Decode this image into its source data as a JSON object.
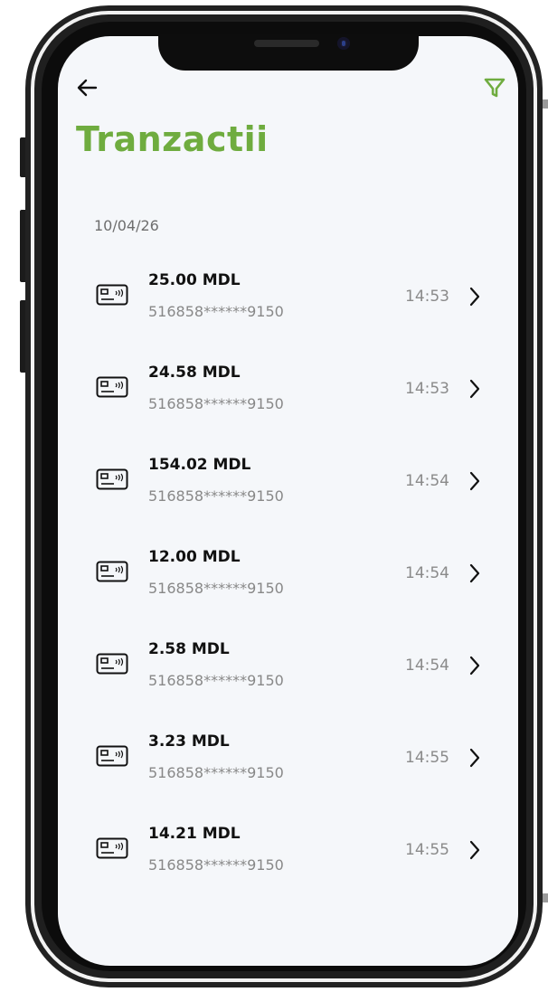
{
  "header": {
    "title": "Tranzactii",
    "back_icon": "back-arrow-icon",
    "filter_icon": "filter-icon"
  },
  "colors": {
    "accent": "#6fac3f",
    "background": "#f5f7fa",
    "amount_text": "#111111",
    "secondary_text": "#888888"
  },
  "date_group": "10/04/26",
  "transactions": [
    {
      "amount": "25.00 MDL",
      "card": "516858******9150",
      "time": "14:53",
      "icon": "contactless-card-icon"
    },
    {
      "amount": "24.58 MDL",
      "card": "516858******9150",
      "time": "14:53",
      "icon": "contactless-card-icon"
    },
    {
      "amount": "154.02 MDL",
      "card": "516858******9150",
      "time": "14:54",
      "icon": "contactless-card-icon"
    },
    {
      "amount": "12.00 MDL",
      "card": "516858******9150",
      "time": "14:54",
      "icon": "contactless-card-icon"
    },
    {
      "amount": "2.58 MDL",
      "card": "516858******9150",
      "time": "14:54",
      "icon": "contactless-card-icon"
    },
    {
      "amount": "3.23 MDL",
      "card": "516858******9150",
      "time": "14:55",
      "icon": "contactless-card-icon"
    },
    {
      "amount": "14.21 MDL",
      "card": "516858******9150",
      "time": "14:55",
      "icon": "contactless-card-icon"
    }
  ]
}
